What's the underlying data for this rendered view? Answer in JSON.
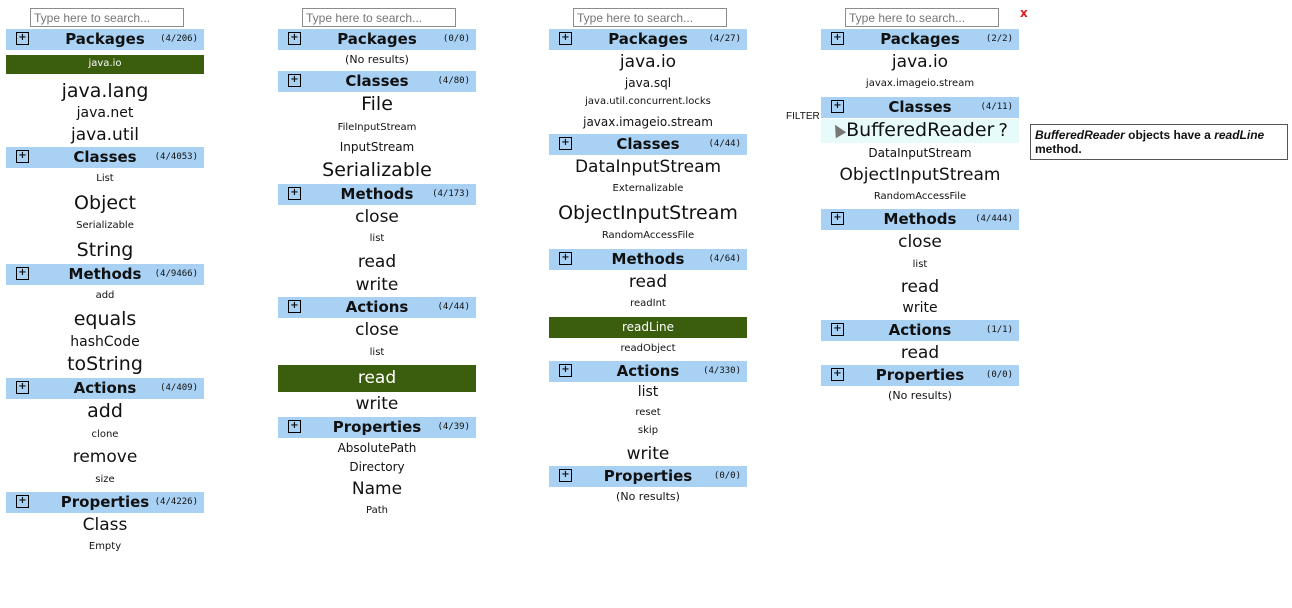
{
  "panels": [
    {
      "search_placeholder": "Type here to search...",
      "sections": [
        {
          "title": "Packages",
          "count": "(4/206)",
          "items": [
            {
              "text": "java.io",
              "size": 1,
              "selected": true
            },
            {
              "text": "java.lang",
              "size": 5
            },
            {
              "text": "java.net",
              "size": 3
            },
            {
              "text": "java.util",
              "size": 4
            }
          ]
        },
        {
          "title": "Classes",
          "count": "(4/4053)",
          "items": [
            {
              "text": "List",
              "size": 1
            },
            {
              "text": "Object",
              "size": 5
            },
            {
              "text": "Serializable",
              "size": 1
            },
            {
              "text": "String",
              "size": 5
            }
          ]
        },
        {
          "title": "Methods",
          "count": "(4/9466)",
          "items": [
            {
              "text": "add",
              "size": 1
            },
            {
              "text": "equals",
              "size": 5
            },
            {
              "text": "hashCode",
              "size": 3
            },
            {
              "text": "toString",
              "size": 5
            }
          ]
        },
        {
          "title": "Actions",
          "count": "(4/409)",
          "items": [
            {
              "text": "add",
              "size": 5
            },
            {
              "text": "clone",
              "size": 1
            },
            {
              "text": "remove",
              "size": 4
            },
            {
              "text": "size",
              "size": 1
            }
          ]
        },
        {
          "title": "Properties",
          "count": "(4/4226)",
          "items": [
            {
              "text": "Class",
              "size": 4
            },
            {
              "text": "Empty",
              "size": 1
            }
          ]
        }
      ]
    },
    {
      "search_placeholder": "Type here to search...",
      "sections": [
        {
          "title": "Packages",
          "count": "(0/0)",
          "noresults": "(No results)",
          "items": []
        },
        {
          "title": "Classes",
          "count": "(4/80)",
          "items": [
            {
              "text": "File",
              "size": 5
            },
            {
              "text": "FileInputStream",
              "size": 1
            },
            {
              "text": "InputStream",
              "size": 2
            },
            {
              "text": "Serializable",
              "size": 5
            }
          ]
        },
        {
          "title": "Methods",
          "count": "(4/173)",
          "items": [
            {
              "text": "close",
              "size": 4
            },
            {
              "text": "list",
              "size": 1
            },
            {
              "text": "read",
              "size": 4
            },
            {
              "text": "write",
              "size": 4
            }
          ]
        },
        {
          "title": "Actions",
          "count": "(4/44)",
          "items": [
            {
              "text": "close",
              "size": 4
            },
            {
              "text": "list",
              "size": 1
            },
            {
              "text": "read",
              "size": 4,
              "selected": true
            },
            {
              "text": "write",
              "size": 4
            }
          ]
        },
        {
          "title": "Properties",
          "count": "(4/39)",
          "items": [
            {
              "text": "AbsolutePath",
              "size": 2
            },
            {
              "text": "Directory",
              "size": 2
            },
            {
              "text": "Name",
              "size": 4
            },
            {
              "text": "Path",
              "size": 1
            }
          ]
        }
      ]
    },
    {
      "search_placeholder": "Type here to search...",
      "sections": [
        {
          "title": "Packages",
          "count": "(4/27)",
          "items": [
            {
              "text": "java.io",
              "size": 4
            },
            {
              "text": "java.sql",
              "size": 2
            },
            {
              "text": "java.util.concurrent.locks",
              "size": 1
            },
            {
              "text": "javax.imageio.stream",
              "size": 2
            }
          ]
        },
        {
          "title": "Classes",
          "count": "(4/44)",
          "items": [
            {
              "text": "DataInputStream",
              "size": 4
            },
            {
              "text": "Externalizable",
              "size": 1
            },
            {
              "text": "ObjectInputStream",
              "size": 5
            },
            {
              "text": "RandomAccessFile",
              "size": 1
            }
          ]
        },
        {
          "title": "Methods",
          "count": "(4/64)",
          "items": [
            {
              "text": "read",
              "size": 4
            },
            {
              "text": "readInt",
              "size": 1
            },
            {
              "text": "readLine",
              "size": 2,
              "selected": true
            },
            {
              "text": "readObject",
              "size": 1
            }
          ]
        },
        {
          "title": "Actions",
          "count": "(4/330)",
          "items": [
            {
              "text": "list",
              "size": 3
            },
            {
              "text": "reset",
              "size": 1
            },
            {
              "text": "skip",
              "size": 1
            },
            {
              "text": "write",
              "size": 4
            }
          ]
        },
        {
          "title": "Properties",
          "count": "(0/0)",
          "noresults": "(No results)",
          "items": []
        }
      ]
    },
    {
      "search_placeholder": "Type here to search...",
      "sections": [
        {
          "title": "Packages",
          "count": "(2/2)",
          "items": [
            {
              "text": "java.io",
              "size": 4
            },
            {
              "text": "javax.imageio.stream",
              "size": 1
            }
          ]
        },
        {
          "title": "Classes",
          "count": "(4/11)",
          "items": [
            {
              "text": "BufferedReader",
              "size": 5,
              "hover": true
            },
            {
              "text": "DataInputStream",
              "size": 2
            },
            {
              "text": "ObjectInputStream",
              "size": 4
            },
            {
              "text": "RandomAccessFile",
              "size": 1
            }
          ]
        },
        {
          "title": "Methods",
          "count": "(4/444)",
          "items": [
            {
              "text": "close",
              "size": 4
            },
            {
              "text": "list",
              "size": 1
            },
            {
              "text": "read",
              "size": 4
            },
            {
              "text": "write",
              "size": 3
            }
          ]
        },
        {
          "title": "Actions",
          "count": "(1/1)",
          "items": [
            {
              "text": "read",
              "size": 4
            }
          ]
        },
        {
          "title": "Properties",
          "count": "(0/0)",
          "noresults": "(No results)",
          "items": []
        }
      ]
    }
  ],
  "plus_glyph": "⊞",
  "close_label": "x",
  "filter_label": "FILTER",
  "help_glyph": "?",
  "tooltip": {
    "class_name": "BufferedReader",
    "text1": " objects have a ",
    "method": "readLine",
    "text2": " method."
  },
  "colors": {
    "header": "#a9d1f4",
    "selected": "#3a5d0e",
    "close": "#d62020"
  }
}
